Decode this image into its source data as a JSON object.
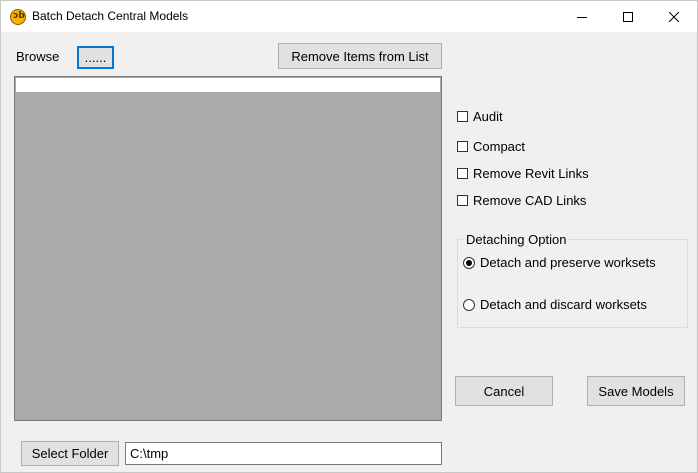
{
  "window": {
    "title": "Batch Detach Central Models",
    "app_icon": "revit-addin-icon",
    "controls": [
      "minimize-icon",
      "maximize-icon",
      "close-icon"
    ]
  },
  "browse": {
    "label": "Browse",
    "button_label": "......"
  },
  "remove_items_button": "Remove Items from List",
  "model_list": {
    "items": []
  },
  "options": {
    "audit": {
      "label": "Audit",
      "checked": false
    },
    "compact": {
      "label": "Compact",
      "checked": false
    },
    "remove_revit_links": {
      "label": "Remove Revit Links",
      "checked": false
    },
    "remove_cad_links": {
      "label": "Remove CAD Links",
      "checked": false
    }
  },
  "detaching_option": {
    "legend": "Detaching Option",
    "preserve": {
      "label": "Detach and preserve worksets",
      "selected": true
    },
    "discard": {
      "label": "Detach and discard worksets",
      "selected": false
    }
  },
  "footer": {
    "cancel_label": "Cancel",
    "save_label": "Save Models",
    "select_folder_label": "Select Folder",
    "folder_path": "C:\\tmp"
  },
  "colors": {
    "window_bg": "#f0f0f0",
    "list_bg": "#ababab",
    "focus_border": "#0078d7",
    "button_bg": "#e1e1e1"
  }
}
